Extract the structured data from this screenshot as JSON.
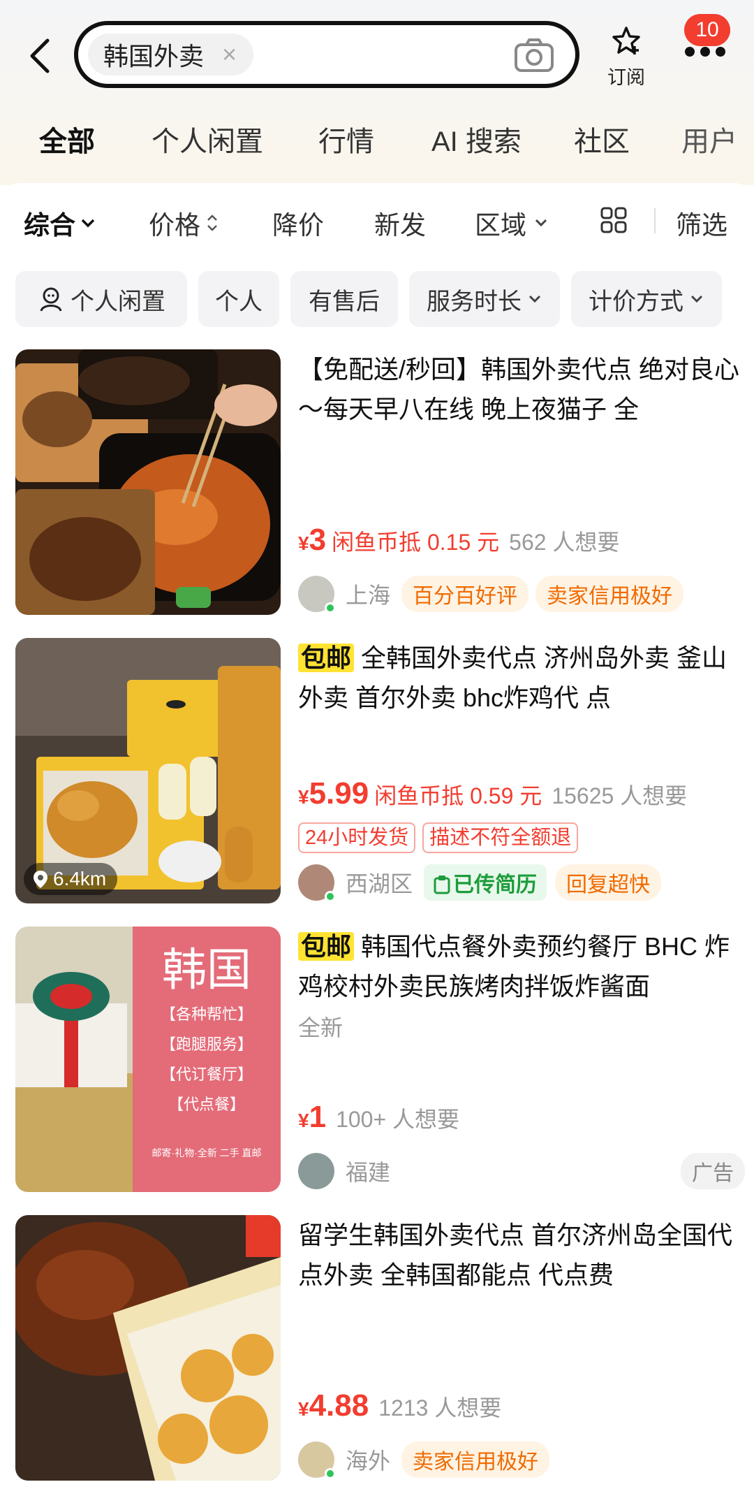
{
  "header": {
    "search_query": "韩国外卖",
    "clear_icon": "×",
    "subscribe_label": "订阅",
    "badge_count": "10"
  },
  "tabs": [
    {
      "label": "全部",
      "active": true
    },
    {
      "label": "个人闲置"
    },
    {
      "label": "行情"
    },
    {
      "label": "AI 搜索"
    },
    {
      "label": "社区"
    },
    {
      "label": "用户"
    }
  ],
  "filters": {
    "sort": "综合",
    "price": "价格",
    "price_drop": "降价",
    "new": "新发",
    "region": "区域",
    "filter": "筛选"
  },
  "pills": [
    "个人闲置",
    "个人",
    "有售后",
    "服务时长",
    "计价方式"
  ],
  "items": [
    {
      "title": "【免配送/秒回】韩国外卖代点 绝对良心～每天早八在线 晚上夜猫子 全",
      "yen": "¥",
      "price": "3",
      "coin": "闲鱼币抵 0.15 元",
      "want": "562 人想要",
      "location": "上海",
      "tags": [
        "百分百好评",
        "卖家信用极好"
      ]
    },
    {
      "prefix": "包邮",
      "title": "全韩国外卖代点 济州岛外卖 釜山外卖 首尔外卖 bhc炸鸡代 点",
      "yen": "¥",
      "price": "5.99",
      "coin": "闲鱼币抵 0.59 元",
      "want": "15625 人想要",
      "red_tags": [
        "24小时发货",
        "描述不符全额退"
      ],
      "location": "西湖区",
      "resume_tag": "已传简历",
      "tags": [
        "回复超快"
      ],
      "distance": "6.4km"
    },
    {
      "prefix": "包邮",
      "title": "韩国代点餐外卖预约餐厅 BHC 炸鸡校村外卖民族烤肉拌饭炸酱面",
      "condition": "全新",
      "yen": "¥",
      "price": "1",
      "want": "100+ 人想要",
      "location": "福建",
      "ad": "广告",
      "image_text": {
        "big": "韩国",
        "lines": [
          "【各种帮忙】",
          "【跑腿服务】",
          "【代订餐厅】",
          "【代点餐】"
        ],
        "footer": "邮寄·礼物·全新 二手 直邮"
      }
    },
    {
      "title": "留学生韩国外卖代点 首尔济州岛全国代点外卖 全韩国都能点 代点费",
      "yen": "¥",
      "price": "4.88",
      "want": "1213 人想要",
      "location": "海外",
      "tags": [
        "卖家信用极好"
      ]
    }
  ],
  "colors": {
    "accent_yellow": "#ffe333",
    "price_red": "#f23d2f",
    "tag_orange": "#f06a00"
  }
}
